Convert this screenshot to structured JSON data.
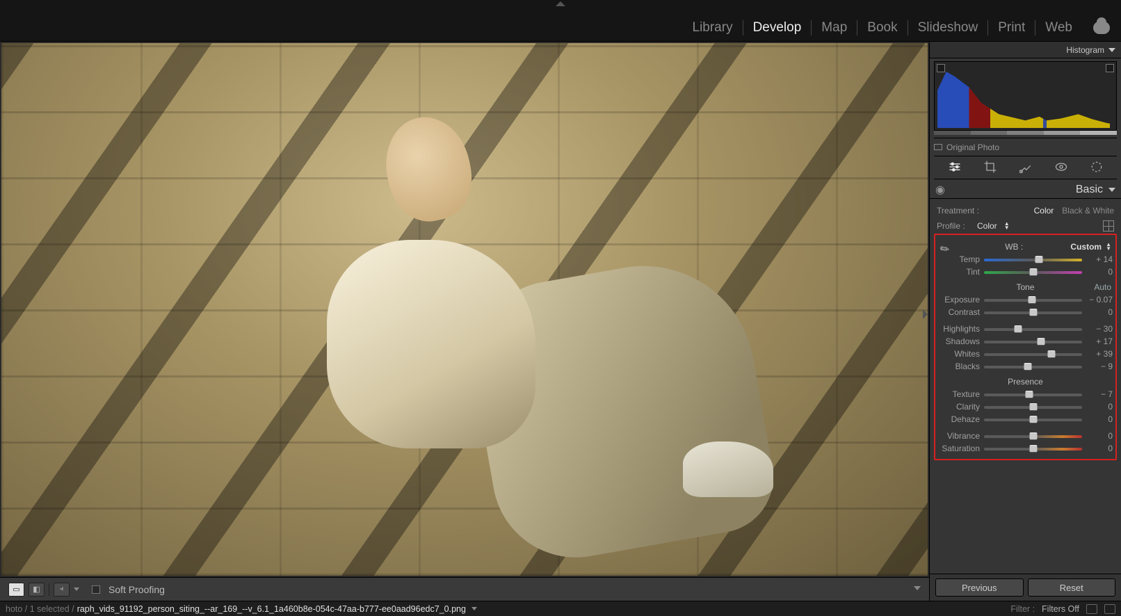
{
  "modules": [
    "Library",
    "Develop",
    "Map",
    "Book",
    "Slideshow",
    "Print",
    "Web"
  ],
  "active_module": "Develop",
  "histogram_label": "Histogram",
  "original_photo_label": "Original Photo",
  "basic": {
    "title": "Basic",
    "treatment_label": "Treatment :",
    "treatment_color": "Color",
    "treatment_bw": "Black & White",
    "profile_label": "Profile :",
    "profile_value": "Color",
    "wb_label": "WB :",
    "wb_value": "Custom",
    "tone_label": "Tone",
    "auto_label": "Auto",
    "presence_label": "Presence",
    "sliders": {
      "temp": {
        "label": "Temp",
        "value": "+ 14",
        "pos": 56
      },
      "tint": {
        "label": "Tint",
        "value": "0",
        "pos": 50
      },
      "exposure": {
        "label": "Exposure",
        "value": "− 0.07",
        "pos": 49
      },
      "contrast": {
        "label": "Contrast",
        "value": "0",
        "pos": 50
      },
      "highlights": {
        "label": "Highlights",
        "value": "− 30",
        "pos": 35
      },
      "shadows": {
        "label": "Shadows",
        "value": "+ 17",
        "pos": 58
      },
      "whites": {
        "label": "Whites",
        "value": "+ 39",
        "pos": 69
      },
      "blacks": {
        "label": "Blacks",
        "value": "− 9",
        "pos": 45
      },
      "texture": {
        "label": "Texture",
        "value": "− 7",
        "pos": 46
      },
      "clarity": {
        "label": "Clarity",
        "value": "0",
        "pos": 50
      },
      "dehaze": {
        "label": "Dehaze",
        "value": "0",
        "pos": 50
      },
      "vibrance": {
        "label": "Vibrance",
        "value": "0",
        "pos": 50
      },
      "saturation": {
        "label": "Saturation",
        "value": "0",
        "pos": 50
      }
    }
  },
  "footer": {
    "previous": "Previous",
    "reset": "Reset"
  },
  "canvas_toolbar": {
    "soft_proofing": "Soft Proofing"
  },
  "status": {
    "prefix": "hoto  / 1 selected  /",
    "filename": "raph_vids_91192_person_siting_--ar_169_--v_6.1_1a460b8e-054c-47aa-b777-ee0aad96edc7_0.png",
    "filter_label": "Filter :",
    "filter_value": "Filters Off"
  }
}
